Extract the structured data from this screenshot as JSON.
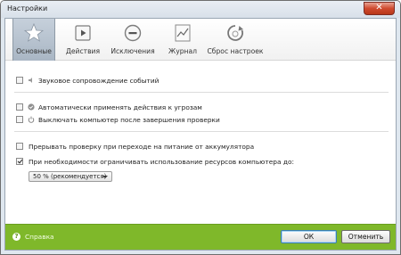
{
  "window": {
    "title": "Настройки",
    "close_symbol": "✕"
  },
  "tabs": [
    {
      "label": "Основные",
      "icon": "star-icon",
      "active": true
    },
    {
      "label": "Действия",
      "icon": "play-icon",
      "active": false
    },
    {
      "label": "Исключения",
      "icon": "minus-circle-icon",
      "active": false
    },
    {
      "label": "Журнал",
      "icon": "chart-icon",
      "active": false
    },
    {
      "label": "Сброс настроек",
      "icon": "reset-icon",
      "active": false
    }
  ],
  "options": {
    "sound": {
      "label": "Звуковое сопровождение событий",
      "checked": false,
      "icon": "speaker-icon"
    },
    "auto_actions": {
      "label": "Автоматически применять действия к угрозам",
      "checked": false,
      "icon": "shield-check-icon"
    },
    "shutdown": {
      "label": "Выключать компьютер после завершения проверки",
      "checked": false,
      "icon": "power-icon"
    },
    "battery": {
      "label": "Прерывать проверку при переходе на питание от аккумулятора",
      "checked": false
    },
    "limit_resources": {
      "label": "При необходимости ограничивать использование ресурсов компьютера до:",
      "checked": true
    }
  },
  "resource_select": {
    "value": "50 % (рекомендуется)"
  },
  "footer": {
    "help_label": "Справка",
    "help_icon_glyph": "?",
    "ok_label": "ОК",
    "cancel_label": "Отменить",
    "accent_color": "#7fb82a"
  }
}
